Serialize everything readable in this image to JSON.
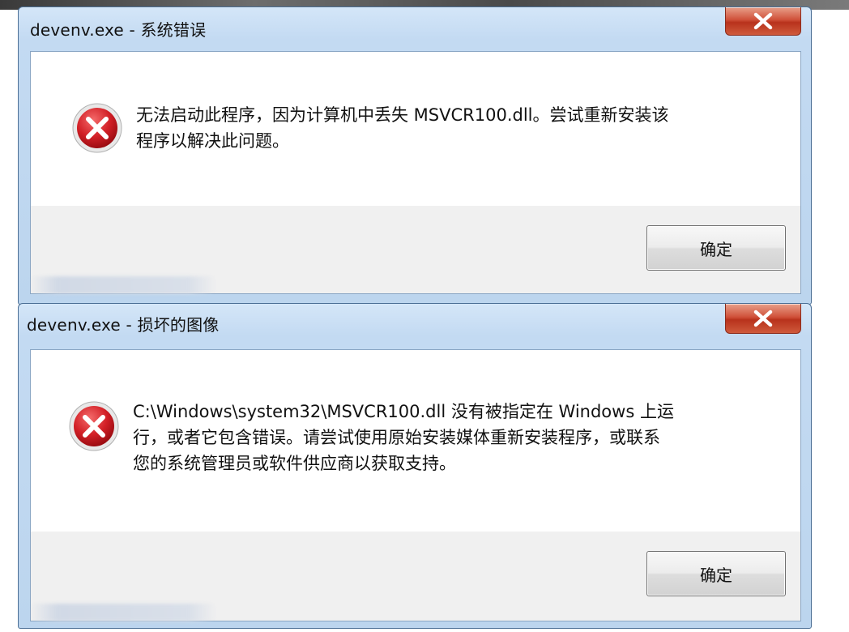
{
  "dialogs": [
    {
      "title": "devenv.exe - 系统错误",
      "icon": "error-icon",
      "message": "无法启动此程序，因为计算机中丢失 MSVCR100.dll。尝试重新安装该\n程序以解决此问题。",
      "ok_label": "确定",
      "close_label": "X"
    },
    {
      "title": "devenv.exe - 损坏的图像",
      "icon": "error-icon",
      "message": "C:\\Windows\\system32\\MSVCR100.dll 没有被指定在 Windows 上运\n行，或者它包含错误。请尝试使用原始安装媒体重新安装程序，或联系\n您的系统管理员或软件供应商以获取支持。",
      "ok_label": "确定",
      "close_label": "X"
    }
  ],
  "colors": {
    "title_bar": "#c3daf2",
    "close_button": "#c9472e",
    "error_red": "#d21f26",
    "button_face": "#e6e6e6"
  }
}
